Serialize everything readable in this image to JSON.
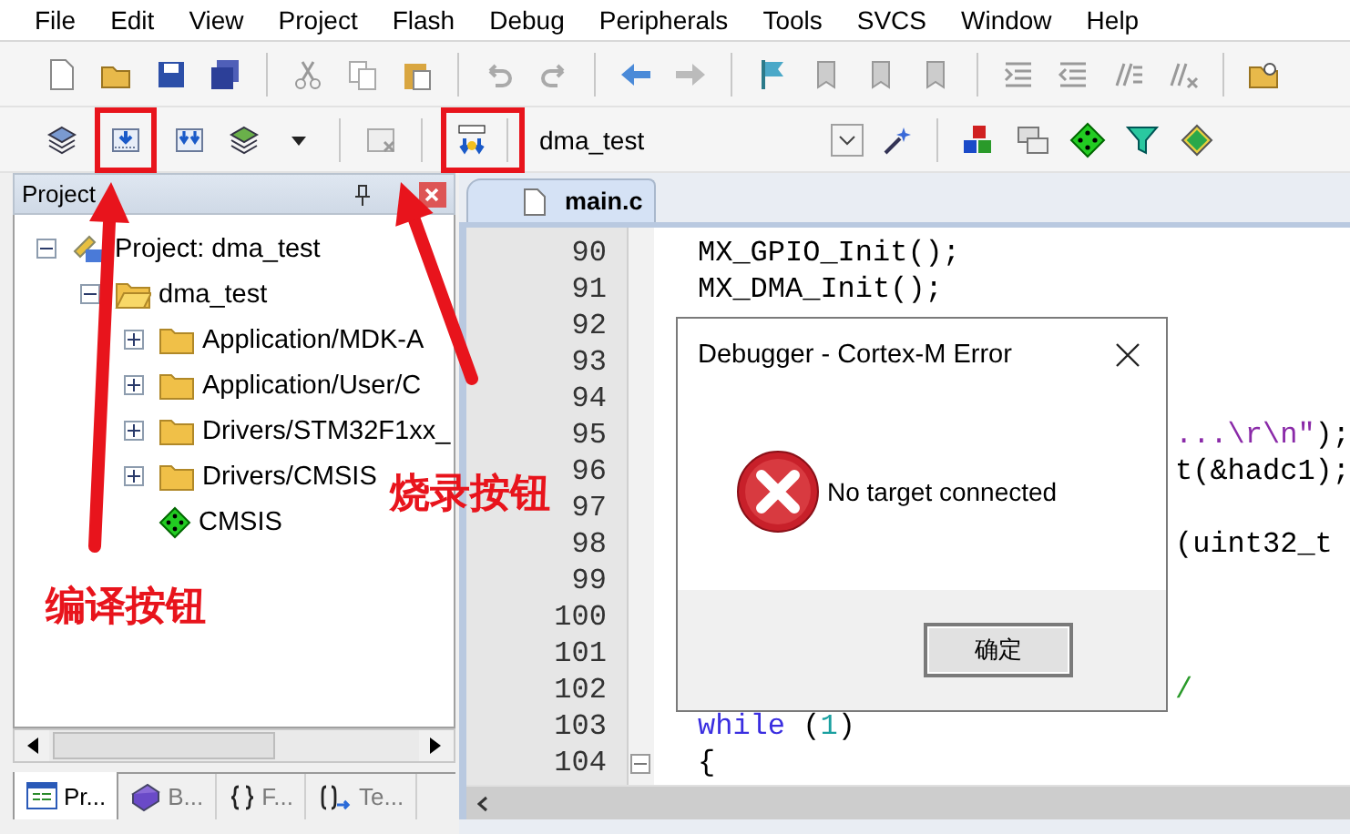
{
  "menu": [
    "File",
    "Edit",
    "View",
    "Project",
    "Flash",
    "Debug",
    "Peripherals",
    "Tools",
    "SVCS",
    "Window",
    "Help"
  ],
  "toolbar": {
    "target": "dma_test"
  },
  "project_panel": {
    "title": "Project",
    "tree": [
      {
        "label": "Project: dma_test",
        "kind": "project",
        "expanded": true,
        "children": [
          {
            "label": "dma_test",
            "kind": "target",
            "expanded": true,
            "children": [
              {
                "label": "Application/MDK-A",
                "kind": "group",
                "expanded": false
              },
              {
                "label": "Application/User/C",
                "kind": "group",
                "expanded": false
              },
              {
                "label": "Drivers/STM32F1xx_",
                "kind": "group",
                "expanded": false
              },
              {
                "label": "Drivers/CMSIS",
                "kind": "group",
                "expanded": false
              },
              {
                "label": "CMSIS",
                "kind": "component"
              }
            ]
          }
        ]
      }
    ],
    "tabs": [
      {
        "label": "Pr...",
        "kind": "project",
        "selected": true
      },
      {
        "label": "B...",
        "kind": "books",
        "selected": false
      },
      {
        "label": "F...",
        "kind": "functions",
        "selected": false
      },
      {
        "label": "Te...",
        "kind": "templates",
        "selected": false
      }
    ]
  },
  "editor": {
    "tab": {
      "label": "main.c",
      "selected": true
    },
    "lines": [
      {
        "number": "90",
        "covered": false,
        "fold": false,
        "segments": [
          {
            "kind": "plain",
            "text": "MX_GPIO_Init();"
          }
        ]
      },
      {
        "number": "91",
        "covered": false,
        "fold": false,
        "segments": [
          {
            "kind": "plain",
            "text": "MX_DMA_Init();"
          }
        ]
      },
      {
        "number": "92",
        "covered": false,
        "fold": false
      },
      {
        "number": "93",
        "covered": false,
        "fold": false
      },
      {
        "number": "94",
        "covered": false,
        "fold": false
      },
      {
        "number": "95",
        "covered": true,
        "fold": false,
        "segments": [
          {
            "kind": "string",
            "text": "...\\r\\n\""
          },
          {
            "kind": "plain",
            "text": ");"
          }
        ]
      },
      {
        "number": "96",
        "covered": true,
        "fold": false,
        "segments": [
          {
            "kind": "plain",
            "text": "t(&hadc1);"
          }
        ]
      },
      {
        "number": "97",
        "covered": false,
        "fold": false
      },
      {
        "number": "98",
        "covered": true,
        "fold": false,
        "segments": [
          {
            "kind": "plain",
            "text": "(uint32_t"
          }
        ]
      },
      {
        "number": "99",
        "covered": false,
        "fold": false
      },
      {
        "number": "100",
        "covered": false,
        "fold": false
      },
      {
        "number": "101",
        "covered": false,
        "fold": false
      },
      {
        "number": "102",
        "covered": true,
        "fold": false,
        "segments": [
          {
            "kind": "comment",
            "text": "/"
          }
        ]
      },
      {
        "number": "103",
        "covered": false,
        "fold": false,
        "segments": [
          {
            "kind": "keyword",
            "text": "while"
          },
          {
            "kind": "plain",
            "text": " ("
          },
          {
            "kind": "number",
            "text": "1"
          },
          {
            "kind": "plain",
            "text": ")"
          }
        ]
      },
      {
        "number": "104",
        "covered": false,
        "fold": true,
        "segments": [
          {
            "kind": "plain",
            "text": "{"
          }
        ]
      }
    ]
  },
  "dialog": {
    "title": "Debugger - Cortex-M Error",
    "message": "No target connected",
    "button": "确定"
  },
  "callouts": [
    {
      "kind": "build",
      "label": "编译按钮"
    },
    {
      "kind": "download",
      "label": "烧录按钮"
    }
  ]
}
